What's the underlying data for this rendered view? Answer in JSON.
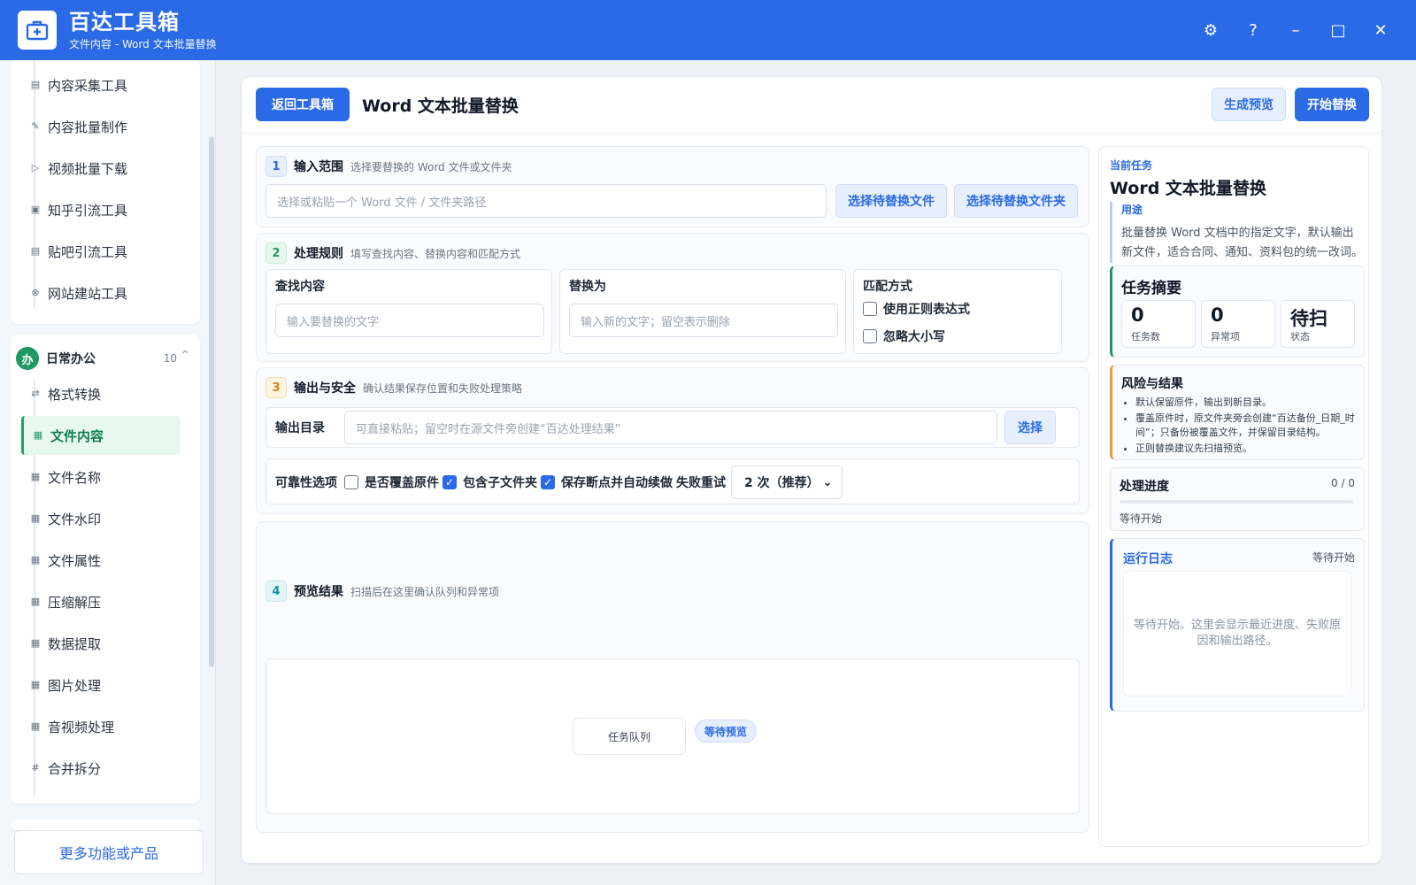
{
  "app": {
    "title": "百达工具箱",
    "subtitle": "文件内容 - Word 文本批量替换",
    "brand_color": "#2a6ae6"
  },
  "window_controls": {
    "settings_icon": "⚙",
    "help_icon": "?",
    "minimize_icon": "–",
    "maximize_icon": "□",
    "close_icon": "✕"
  },
  "sidebar": {
    "top_items": [
      {
        "label": "内容采集工具",
        "icon": "doc-icon"
      },
      {
        "label": "内容批量制作",
        "icon": "pen-icon"
      },
      {
        "label": "视频批量下载",
        "icon": "video-icon"
      },
      {
        "label": "知乎引流工具",
        "icon": "zhihu-icon"
      },
      {
        "label": "贴吧引流工具",
        "icon": "tieba-icon"
      },
      {
        "label": "网站建站工具",
        "icon": "web-icon"
      }
    ],
    "group": {
      "badge": "办",
      "name": "日常办公",
      "count": "10",
      "caret": "^"
    },
    "group_items": [
      {
        "label": "格式转换",
        "icon": "⇄"
      },
      {
        "label": "文件内容",
        "icon": "▦"
      },
      {
        "label": "文件名称",
        "icon": "▦"
      },
      {
        "label": "文件水印",
        "icon": "▦"
      },
      {
        "label": "文件属性",
        "icon": "▦"
      },
      {
        "label": "压缩解压",
        "icon": "▦"
      },
      {
        "label": "数据提取",
        "icon": "▦"
      },
      {
        "label": "图片处理",
        "icon": "▦"
      },
      {
        "label": "音视频处理",
        "icon": "▦"
      },
      {
        "label": "合并拆分",
        "icon": "#"
      }
    ],
    "active_item": "文件内容",
    "more_button": "更多功能或产品"
  },
  "toolbar": {
    "back_button": "返回工具箱",
    "page_title": "Word 文本批量替换",
    "preview_button": "生成预览",
    "start_button": "开始替换"
  },
  "section1": {
    "step": "1",
    "title": "输入范围",
    "desc": "选择要替换的 Word 文件或文件夹",
    "path_placeholder": "选择或粘贴一个 Word 文件 / 文件夹路径",
    "select_file_button": "选择待替换文件",
    "select_folder_button": "选择待替换文件夹"
  },
  "section2": {
    "step": "2",
    "title": "处理规则",
    "desc": "填写查找内容、替换内容和匹配方式",
    "find_label": "查找内容",
    "find_placeholder": "输入要替换的文字",
    "replace_label": "替换为",
    "replace_placeholder": "输入新的文字；留空表示删除",
    "match_label": "匹配方式",
    "regex_label": "使用正则表达式",
    "regex_checked": false,
    "ignore_case_label": "忽略大小写",
    "ignore_case_checked": false
  },
  "section3": {
    "step": "3",
    "title": "输出与安全",
    "desc": "确认结果保存位置和失败处理策略",
    "output_label": "输出目录",
    "output_placeholder": "可直接粘贴；留空时在源文件旁创建“百达处理结果”",
    "select_button": "选择",
    "reliability_label": "可靠性选项",
    "overwrite_label": "是否覆盖原件",
    "overwrite_checked": false,
    "subfolder_label": "包含子文件夹",
    "subfolder_checked": true,
    "resume_label": "保存断点并自动续做",
    "resume_checked": true,
    "retry_label": "失败重试",
    "retry_value": "2 次（推荐）"
  },
  "section4": {
    "step": "4",
    "title": "预览结果",
    "desc": "扫描后在这里确认队列和异常项",
    "queue_label": "任务队列",
    "queue_status": "等待预览"
  },
  "right_panel": {
    "tag": "当前任务",
    "title": "Word 文本批量替换",
    "use_label": "用途",
    "use_text": "批量替换 Word 文档中的指定文字，默认输出新文件，适合合同、通知、资料包的统一改词。",
    "summary_title": "任务摘要",
    "stats": [
      {
        "value": "0",
        "label": "任务数"
      },
      {
        "value": "0",
        "label": "异常项"
      },
      {
        "value": "待扫",
        "label": "状态"
      }
    ],
    "risk_title": "风险与结果",
    "risks": [
      "默认保留原件，输出到新目录。",
      "覆盖原件时，原文件夹旁会创建“百达备份_日期_时间”；只备份被覆盖文件，并保留目录结构。",
      "正则替换建议先扫描预览。"
    ],
    "progress_title": "处理进度",
    "progress_count": "0 / 0",
    "progress_value": 0,
    "progress_status": "等待开始",
    "log_title": "运行日志",
    "log_status": "等待开始",
    "log_placeholder": "等待开始。这里会显示最近进度、失败原因和输出路径。"
  }
}
